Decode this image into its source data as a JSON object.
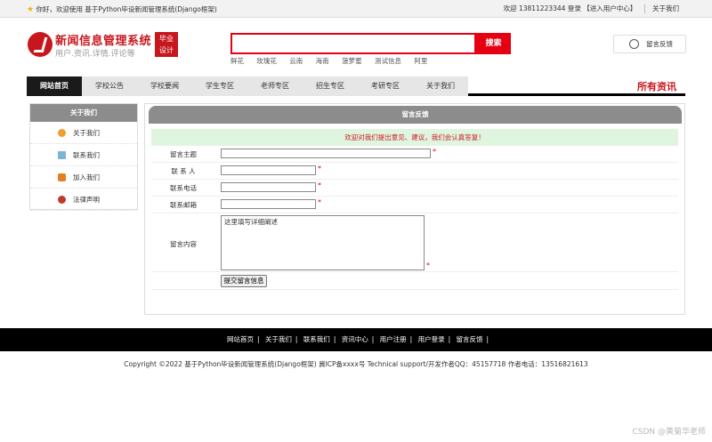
{
  "topbar": {
    "greeting": "你好，欢迎使用 基于Python毕设新闻管理系统(Django框架)",
    "welcome_user": "欢迎 13811223344 登录",
    "user_center": "【进入用户中心】",
    "about": "关于我们"
  },
  "header": {
    "title": "新闻信息管理系统",
    "subtitle": "用户.资讯.详情.评论等",
    "badge_line1": "毕业",
    "badge_line2": "设计",
    "search_placeholder": "",
    "search_button": "搜索",
    "hotwords": [
      "鲜花",
      "玫瑰花",
      "云南",
      "海南",
      "菠萝蜜",
      "测试信息",
      "阿里"
    ],
    "feedback_button": "留言反馈"
  },
  "nav": {
    "items": [
      "网站首页",
      "学校公告",
      "学校要闻",
      "学生专区",
      "老师专区",
      "招生专区",
      "考研专区",
      "关于我们"
    ],
    "right_title": "所有资讯"
  },
  "sidebar": {
    "title": "关于我们",
    "items": [
      {
        "label": "关于我们",
        "color": "#f39c33"
      },
      {
        "label": "联系我们",
        "color": "#7fb3d5"
      },
      {
        "label": "加入我们",
        "color": "#e67e22"
      },
      {
        "label": "法律声明",
        "color": "#c0392b"
      }
    ]
  },
  "form": {
    "title": "留言反馈",
    "welcome": "欢迎对我们提出意见、建议，我们会认真答复！",
    "subject_label": "留言主题",
    "contact_label": "联 系 人",
    "phone_label": "联系电话",
    "email_label": "联系邮箱",
    "content_label": "留言内容",
    "content_placeholder": "这里填写详细阐述",
    "required_mark": "*",
    "submit_button": "提交留言信息"
  },
  "footer": {
    "links": [
      "网站首页",
      "关于我们",
      "联系我们",
      "资讯中心",
      "用户注册",
      "用户登录",
      "留言反馈"
    ],
    "separator": "|",
    "copyright": "Copyright ©2022 基于Python毕设新闻管理系统(Django框架) 冀ICP备xxxx号   Technical support/开发作者QQ：45157718    作者电话：13516821613"
  },
  "watermark": "CSDN @黄菊华老师"
}
